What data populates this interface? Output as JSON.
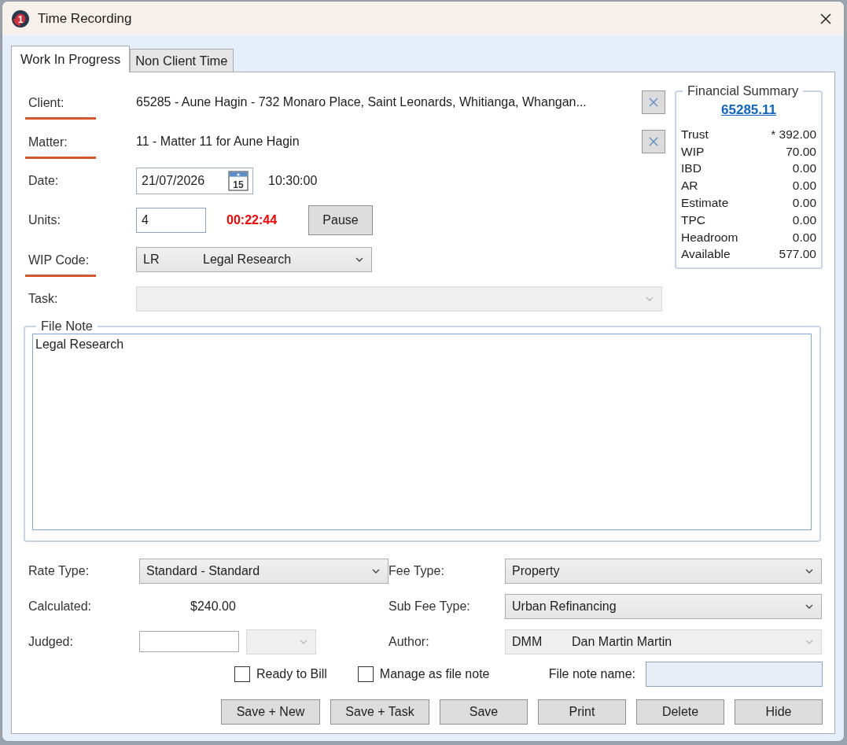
{
  "window": {
    "title": "Time Recording",
    "logo_text": "1"
  },
  "tabs": [
    {
      "label": "Work In Progress",
      "selected": true
    },
    {
      "label": "Non Client Time",
      "selected": false
    }
  ],
  "fields": [
    {
      "kind": "text",
      "label": "Client:",
      "required": true,
      "value": "65285 - Aune Hagin - 732 Monaro Place, Saint Leonards, Whitianga, Whangan...",
      "clear_button": true
    },
    {
      "kind": "text",
      "label": "Matter:",
      "required": true,
      "value": "11 - Matter 11 for Aune Hagin",
      "clear_button": true
    },
    {
      "kind": "date",
      "label": "Date:",
      "required": false,
      "value": "21/07/2026",
      "calendar_day": "15",
      "time": "10:30:00"
    },
    {
      "kind": "units",
      "label": "Units:",
      "required": false,
      "value": "4",
      "timer": "00:22:44",
      "button": "Pause"
    },
    {
      "kind": "dropdown",
      "label": "WIP Code:",
      "required": true,
      "code": "LR",
      "value": "Legal Research",
      "disabled": false
    },
    {
      "kind": "dropdown",
      "label": "Task:",
      "required": false,
      "disabled": true
    }
  ],
  "financial_summary": {
    "title": "Financial Summary",
    "link": "65285.11",
    "rows": [
      {
        "label": "Trust",
        "value": "* 392.00"
      },
      {
        "label": "WIP",
        "value": "70.00"
      },
      {
        "label": "IBD",
        "value": "0.00"
      },
      {
        "label": "AR",
        "value": "0.00"
      },
      {
        "label": "Estimate",
        "value": "0.00"
      },
      {
        "label": "TPC",
        "value": "0.00"
      },
      {
        "label": "Headroom",
        "value": "0.00"
      },
      {
        "label": "Available",
        "value": "577.00"
      }
    ]
  },
  "file_note": {
    "title": "File Note",
    "value": "Legal Research"
  },
  "billing": {
    "left": [
      {
        "kind": "dropdown",
        "label": "Rate Type:",
        "value": "Standard - Standard",
        "disabled": false
      },
      {
        "kind": "amount",
        "label": "Calculated:",
        "value": "$240.00"
      },
      {
        "kind": "judged",
        "label": "Judged:",
        "unit_disabled": true
      }
    ],
    "right": [
      {
        "kind": "dropdown",
        "label": "Fee Type:",
        "value": "Property",
        "disabled": false
      },
      {
        "kind": "dropdown",
        "label": "Sub Fee Type:",
        "value": "Urban Refinancing",
        "disabled": false
      },
      {
        "kind": "dropdown",
        "label": "Author:",
        "code": "DMM",
        "value": "Dan Martin Martin",
        "disabled": true
      }
    ]
  },
  "options": {
    "checkboxes": [
      {
        "label": "Ready to Bill",
        "checked": false
      },
      {
        "label": "Manage as file note",
        "checked": false
      }
    ],
    "file_note_name": {
      "label": "File note name:"
    }
  },
  "buttons": [
    "Save + New",
    "Save + Task",
    "Save",
    "Print",
    "Delete",
    "Hide"
  ]
}
